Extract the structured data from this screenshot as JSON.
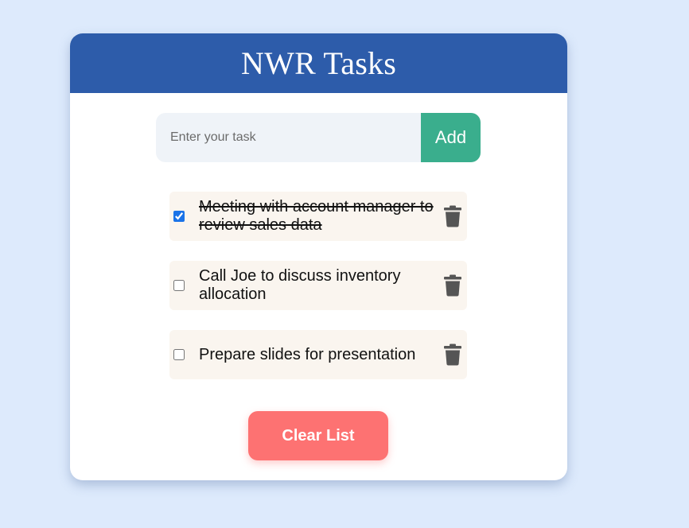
{
  "app": {
    "title": "NWR Tasks"
  },
  "input": {
    "placeholder": "Enter your task",
    "value": ""
  },
  "add_button": {
    "label": "Add"
  },
  "tasks": [
    {
      "text": "Meeting with account manager to review sales data",
      "done": true
    },
    {
      "text": "Call Joe to discuss inventory allocation",
      "done": false
    },
    {
      "text": "Prepare slides for presentation",
      "done": false
    }
  ],
  "clear_button": {
    "label": "Clear List"
  },
  "colors": {
    "header": "#2d5caa",
    "add": "#3aae8d",
    "clear": "#fd7272",
    "background": "#ddeafc",
    "task_bg": "#faf5ef",
    "trash": "#555555"
  },
  "icons": {
    "delete": "trash-icon"
  }
}
